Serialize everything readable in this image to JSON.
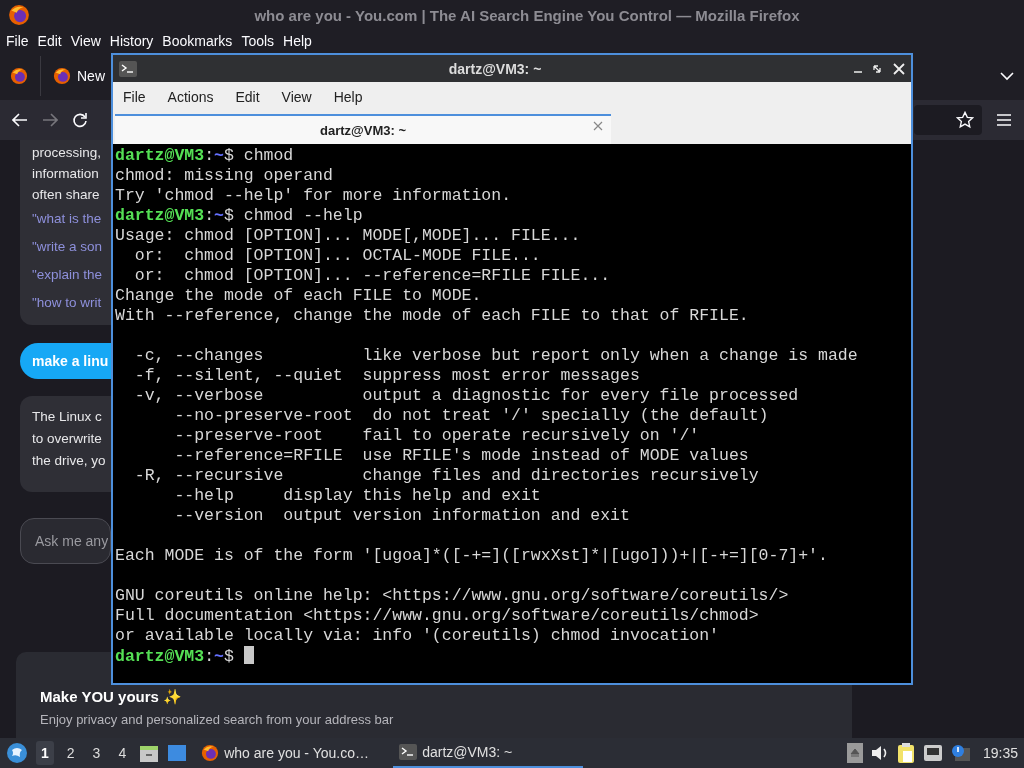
{
  "firefox": {
    "title": "who are you - You.com | The AI Search Engine You Control — Mozilla Firefox",
    "menu": [
      "File",
      "Edit",
      "View",
      "History",
      "Bookmarks",
      "Tools",
      "Help"
    ],
    "tabs": [
      {
        "label": "New"
      }
    ],
    "page": {
      "answer_lines": [
        "processing,",
        "information",
        "often share"
      ],
      "suggestions": [
        "\"what is the",
        "\"write a son",
        "\"explain the",
        "\"how to writ"
      ],
      "query": "make a linu",
      "reply_lines": [
        "The Linux c",
        "to overwrite",
        "the drive, yo"
      ],
      "ask": {
        "placeholder": "Ask me any"
      },
      "banner": {
        "title": "Make YOU yours ✨",
        "text": "Enjoy privacy and personalized search from your address bar"
      }
    }
  },
  "terminal": {
    "title": "dartz@VM3: ~",
    "menu": [
      "File",
      "Actions",
      "Edit",
      "View",
      "Help"
    ],
    "tabs": [
      {
        "label": "dartz@VM3: ~",
        "selected": true
      }
    ],
    "lines": [
      {
        "kind": "prompt",
        "user": "dartz@VM3",
        "separator": ":",
        "path": "~",
        "symbol": "$",
        "command": "chmod"
      },
      {
        "kind": "output",
        "text": "chmod: missing operand"
      },
      {
        "kind": "output",
        "text": "Try 'chmod --help' for more information."
      },
      {
        "kind": "prompt",
        "user": "dartz@VM3",
        "separator": ":",
        "path": "~",
        "symbol": "$",
        "command": "chmod --help"
      },
      {
        "kind": "output",
        "text": "Usage: chmod [OPTION]... MODE[,MODE]... FILE..."
      },
      {
        "kind": "output",
        "text": "  or:  chmod [OPTION]... OCTAL-MODE FILE..."
      },
      {
        "kind": "output",
        "text": "  or:  chmod [OPTION]... --reference=RFILE FILE..."
      },
      {
        "kind": "output",
        "text": "Change the mode of each FILE to MODE."
      },
      {
        "kind": "output",
        "text": "With --reference, change the mode of each FILE to that of RFILE."
      },
      {
        "kind": "blank"
      },
      {
        "kind": "output",
        "text": "  -c, --changes          like verbose but report only when a change is made"
      },
      {
        "kind": "output",
        "text": "  -f, --silent, --quiet  suppress most error messages"
      },
      {
        "kind": "output",
        "text": "  -v, --verbose          output a diagnostic for every file processed"
      },
      {
        "kind": "output",
        "text": "      --no-preserve-root  do not treat '/' specially (the default)"
      },
      {
        "kind": "output",
        "text": "      --preserve-root    fail to operate recursively on '/'"
      },
      {
        "kind": "output",
        "text": "      --reference=RFILE  use RFILE's mode instead of MODE values"
      },
      {
        "kind": "output",
        "text": "  -R, --recursive        change files and directories recursively"
      },
      {
        "kind": "output",
        "text": "      --help     display this help and exit"
      },
      {
        "kind": "output",
        "text": "      --version  output version information and exit"
      },
      {
        "kind": "blank"
      },
      {
        "kind": "output",
        "text": "Each MODE is of the form '[ugoa]*([-+=]([rwxXst]*|[ugo]))+|[-+=][0-7]+'."
      },
      {
        "kind": "blank"
      },
      {
        "kind": "output",
        "text": "GNU coreutils online help: <https://www.gnu.org/software/coreutils/>"
      },
      {
        "kind": "output",
        "text": "Full documentation <https://www.gnu.org/software/coreutils/chmod>"
      },
      {
        "kind": "output",
        "text": "or available locally via: info '(coreutils) chmod invocation'"
      },
      {
        "kind": "prompt",
        "user": "dartz@VM3",
        "separator": ":",
        "path": "~",
        "symbol": "$",
        "cursor": true
      }
    ]
  },
  "taskbar": {
    "workspaces": [
      {
        "label": "1",
        "selected": true
      },
      {
        "label": "2",
        "selected": false
      },
      {
        "label": "3",
        "selected": false
      },
      {
        "label": "4",
        "selected": false
      }
    ],
    "tasks": [
      {
        "kind": "firefox",
        "label": "who are you - You.co…",
        "selected": false
      },
      {
        "kind": "terminal",
        "label": "dartz@VM3: ~",
        "selected": true
      }
    ],
    "clock": "19:35"
  }
}
